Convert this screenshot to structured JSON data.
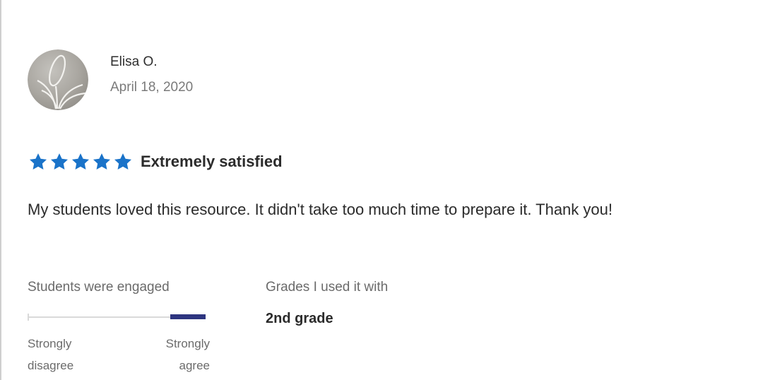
{
  "review": {
    "reviewer": {
      "name": "Elisa O.",
      "date": "April 18, 2020",
      "avatar_icon": "avatar-leaf-logo-icon"
    },
    "rating": {
      "stars": 5,
      "max_stars": 5,
      "label": "Extremely satisfied",
      "star_color": "#1a73c9"
    },
    "text": "My students loved this resource. It didn't take too much time to prepare it. Thank you!",
    "engagement": {
      "title": "Students were engaged",
      "level": 1.0,
      "fill_color": "#2e3580",
      "low_label_line1": "Strongly",
      "low_label_line2": "disagree",
      "high_label_line1": "Strongly",
      "high_label_line2": "agree"
    },
    "grades": {
      "title": "Grades I used it with",
      "value": "2nd grade"
    }
  }
}
